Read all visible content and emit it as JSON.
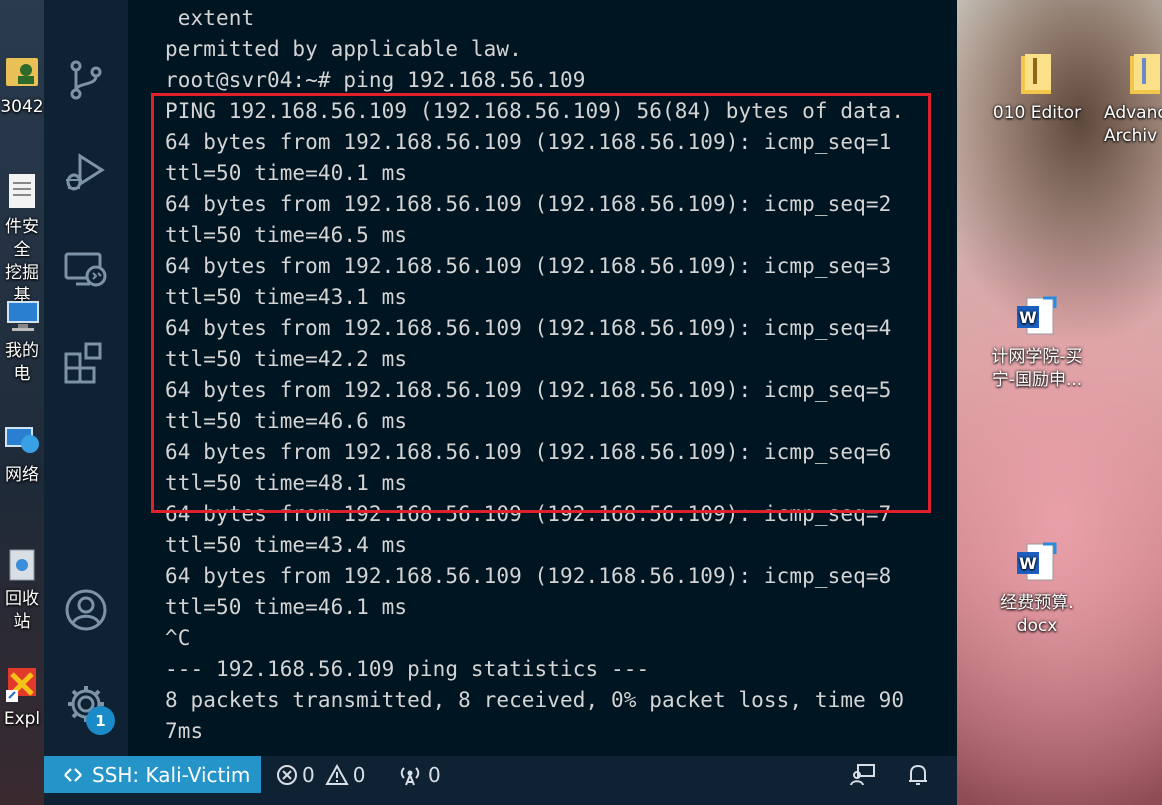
{
  "terminal": {
    "lines": [
      " extent",
      "permitted by applicable law.",
      "root@svr04:~# ping 192.168.56.109",
      "PING 192.168.56.109 (192.168.56.109) 56(84) bytes of data.",
      "64 bytes from 192.168.56.109 (192.168.56.109): icmp_seq=1",
      "ttl=50 time=40.1 ms",
      "64 bytes from 192.168.56.109 (192.168.56.109): icmp_seq=2",
      "ttl=50 time=46.5 ms",
      "64 bytes from 192.168.56.109 (192.168.56.109): icmp_seq=3",
      "ttl=50 time=43.1 ms",
      "64 bytes from 192.168.56.109 (192.168.56.109): icmp_seq=4",
      "ttl=50 time=42.2 ms",
      "64 bytes from 192.168.56.109 (192.168.56.109): icmp_seq=5",
      "ttl=50 time=46.6 ms",
      "64 bytes from 192.168.56.109 (192.168.56.109): icmp_seq=6",
      "ttl=50 time=48.1 ms",
      "64 bytes from 192.168.56.109 (192.168.56.109): icmp_seq=7",
      "ttl=50 time=43.4 ms",
      "64 bytes from 192.168.56.109 (192.168.56.109): icmp_seq=8",
      "ttl=50 time=46.1 ms",
      "^C",
      "--- 192.168.56.109 ping statistics ---",
      "8 packets transmitted, 8 received, 0% packet loss, time 90",
      "7ms"
    ]
  },
  "activity_bar": {
    "icons": [
      "source-control-icon",
      "run-debug-icon",
      "remote-explorer-icon",
      "extensions-icon",
      "account-icon",
      "settings-gear-icon"
    ],
    "settings_badge": "1"
  },
  "statusbar": {
    "remote_label": "SSH: Kali-Victim",
    "errors": "0",
    "warnings": "0",
    "ports": "0"
  },
  "desktop": {
    "left_icons": [
      "3042",
      "件安全",
      "挖掘基",
      "我的电",
      "网络",
      "回收站",
      "Expl"
    ],
    "right_icons": [
      {
        "line1": "010 Editor",
        "line2": ""
      },
      {
        "line1": "Advanc",
        "line2": "Archiv"
      },
      {
        "line1": "计网学院-买",
        "line2": "宁-国励申..."
      },
      {
        "line1": "经费预算.",
        "line2": "docx"
      }
    ]
  },
  "colors": {
    "terminal_bg": "#001522",
    "sidebar_bg": "#0e2233",
    "remote_bg": "#2595c9",
    "highlight_border": "#e0212b"
  }
}
